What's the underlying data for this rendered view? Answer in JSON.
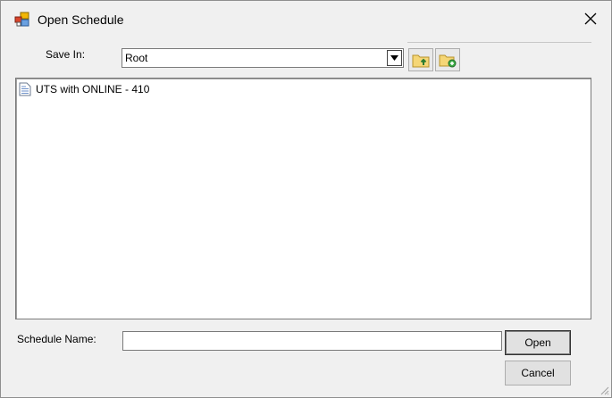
{
  "window": {
    "title": "Open Schedule"
  },
  "toolbar": {
    "save_in_label": "Save In:",
    "save_in_value": "Root",
    "up_folder_icon": "folder-up-icon",
    "new_folder_icon": "new-folder-icon"
  },
  "list": {
    "items": [
      {
        "label": "UTS with ONLINE - 410",
        "icon": "document-icon"
      }
    ]
  },
  "footer": {
    "name_label": "Schedule Name:",
    "name_value": "",
    "open_label": "Open",
    "cancel_label": "Cancel"
  }
}
